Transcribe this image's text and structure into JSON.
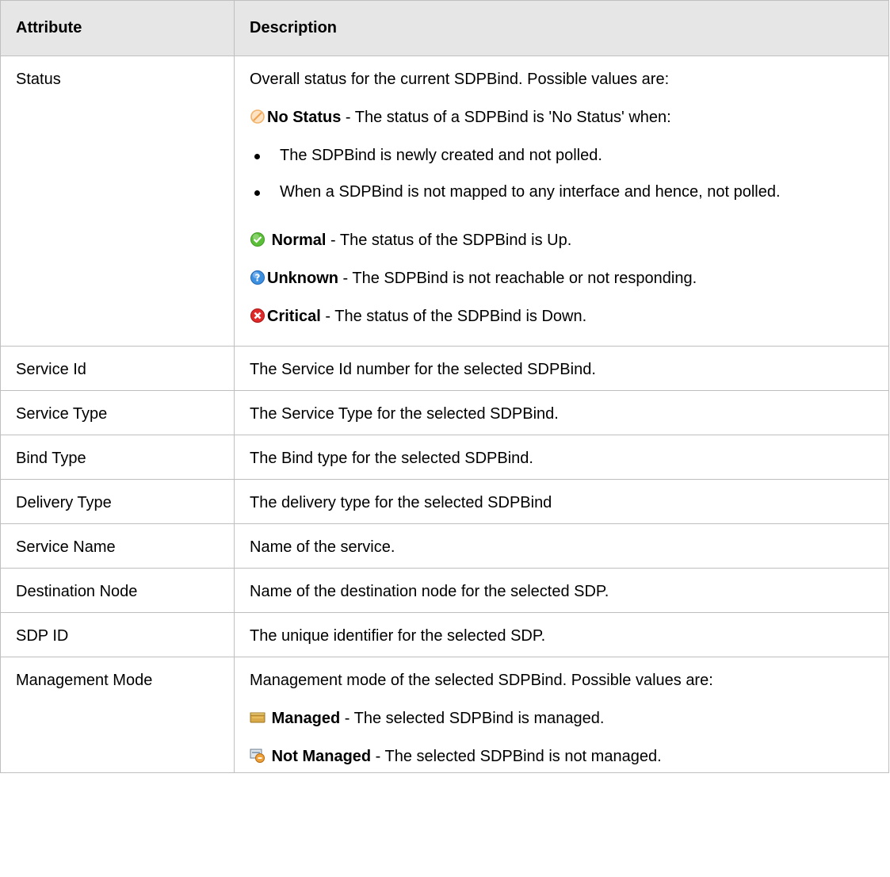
{
  "header": {
    "attribute": "Attribute",
    "description": "Description"
  },
  "status": {
    "attribute": "Status",
    "intro": "Overall status for the current SDPBind. Possible values are:",
    "no_status": {
      "label": "No Status",
      "text": " - The status of a SDPBind is 'No Status' when:",
      "icon": "no-status-icon",
      "bullets": [
        "The SDPBind is newly created and not polled.",
        "When a SDPBind is not mapped to any interface and hence, not polled."
      ]
    },
    "normal": {
      "label": "Normal",
      "text": " - The status of the SDPBind is Up.",
      "icon": "normal-status-icon"
    },
    "unknown": {
      "label": "Unknown",
      "text": " - The SDPBind is not reachable or not responding.",
      "icon": "unknown-status-icon"
    },
    "critical": {
      "label": "Critical",
      "text": " - The status of the SDPBind is Down.",
      "icon": "critical-status-icon"
    }
  },
  "rows": [
    {
      "attribute": "Service Id",
      "description": "The Service Id number for the selected SDPBind."
    },
    {
      "attribute": "Service Type",
      "description": "The Service Type for the selected SDPBind."
    },
    {
      "attribute": "Bind Type",
      "description": "The Bind type for the selected SDPBind."
    },
    {
      "attribute": "Delivery Type",
      "description": "The delivery type for the selected SDPBind"
    },
    {
      "attribute": "Service Name",
      "description": "Name of the service."
    },
    {
      "attribute": "Destination Node",
      "description": "Name of the destination node for the selected SDP."
    },
    {
      "attribute": "SDP ID",
      "description": "The unique identifier for the selected SDP."
    }
  ],
  "management": {
    "attribute": "Management Mode",
    "intro": "Management mode of the selected SDPBind. Possible values are:",
    "managed": {
      "label": "Managed",
      "text": " - The selected SDPBind is managed.",
      "icon": "managed-icon"
    },
    "not_managed": {
      "label": "Not Managed",
      "text": " - The selected SDPBind is not managed.",
      "icon": "not-managed-icon"
    }
  },
  "colors": {
    "header_bg": "#e6e6e6",
    "border": "#bfbfbf"
  }
}
